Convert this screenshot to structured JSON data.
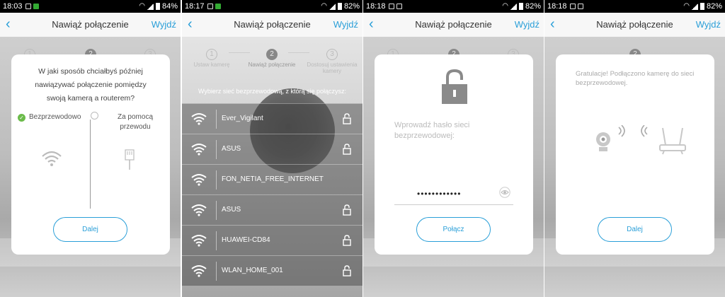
{
  "screens": [
    {
      "status": {
        "time": "18:03",
        "battery": "84%"
      },
      "header": {
        "title": "Nawiąż połączenie",
        "exit": "Wyjdź"
      },
      "steps": [
        "1",
        "2",
        "3"
      ],
      "question": "W jaki sposób chciałbyś później nawiązywać połączenie pomiędzy swoją kamerą a routerem?",
      "option_wireless": "Bezprzewodowo",
      "option_wired": "Za pomocą przewodu",
      "button": "Dalej"
    },
    {
      "status": {
        "time": "18:17",
        "battery": "82%"
      },
      "header": {
        "title": "Nawiąż połączenie",
        "exit": "Wyjdź"
      },
      "steps": [
        {
          "num": "1",
          "label": "Ustaw kamerę"
        },
        {
          "num": "2",
          "label": "Nawiąż połączenie"
        },
        {
          "num": "3",
          "label": "Dostosuj ustawienia kamery"
        }
      ],
      "prompt": "Wybierz sieć bezprzewodową, z którą się połączysz:",
      "networks": [
        {
          "name": "Ever_Vigilant",
          "locked": true
        },
        {
          "name": "ASUS",
          "locked": true
        },
        {
          "name": "FON_NETIA_FREE_INTERNET",
          "locked": false
        },
        {
          "name": "ASUS",
          "locked": true
        },
        {
          "name": "HUAWEI-CD84",
          "locked": true
        },
        {
          "name": "WLAN_HOME_001",
          "locked": true
        }
      ]
    },
    {
      "status": {
        "time": "18:18",
        "battery": "82%"
      },
      "header": {
        "title": "Nawiąż połączenie",
        "exit": "Wyjdź"
      },
      "steps": [
        "1",
        "2",
        "3"
      ],
      "password_label": "Wprowadź hasło sieci bezprzewodowej:",
      "password_value": "••••••••••••",
      "button": "Połącz"
    },
    {
      "status": {
        "time": "18:18",
        "battery": "82%"
      },
      "header": {
        "title": "Nawiąż połączenie",
        "exit": "Wyjdź"
      },
      "steps": [
        "2"
      ],
      "congrats": "Gratulacje! Podłączono kamerę do sieci bezprzewodowej.",
      "button": "Dalej"
    }
  ],
  "colors": {
    "accent": "#2a9fd8",
    "success": "#6bbb4a"
  },
  "icons": [
    "back-chevron-icon",
    "wifi-icon",
    "lock-icon",
    "ethernet-plug-icon",
    "eye-icon",
    "camera-icon",
    "router-icon",
    "check-icon"
  ]
}
